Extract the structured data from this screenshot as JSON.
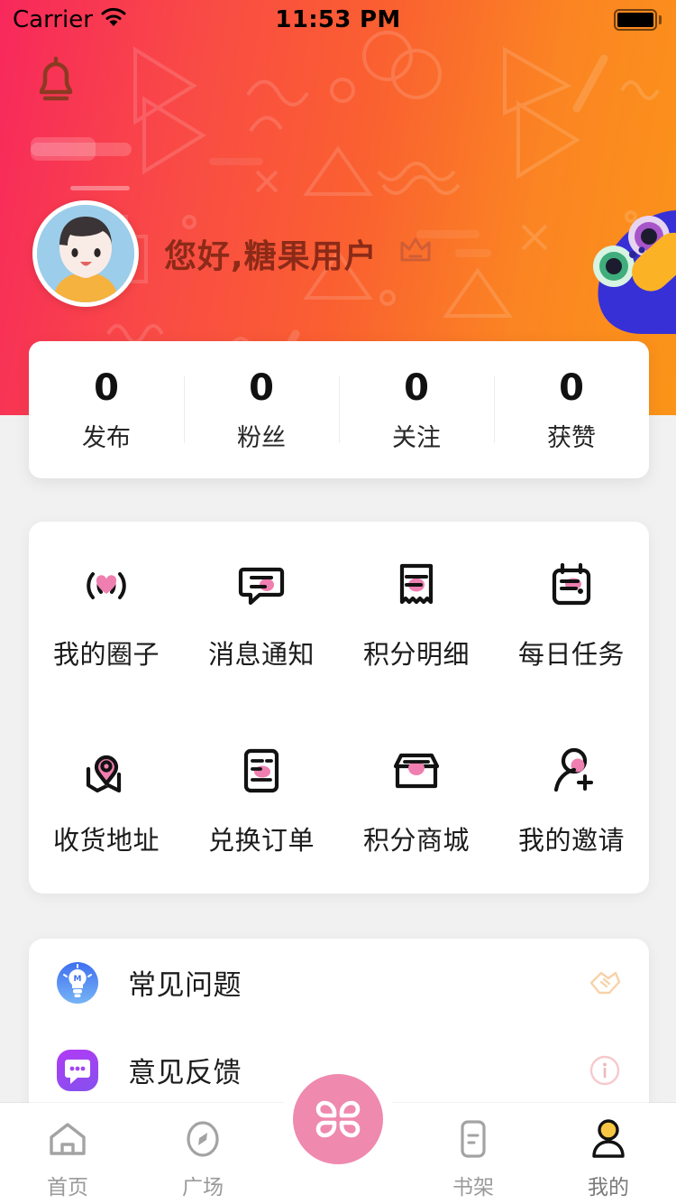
{
  "status_bar": {
    "carrier": "Carrier",
    "wifi_icon": "wifi-icon",
    "time": "11:53 PM",
    "battery_icon": "battery-full-icon"
  },
  "header": {
    "notification_icon": "bell-icon",
    "avatar_icon": "user-avatar",
    "greeting": "您好,糖果用户",
    "crown_icon": "crown-icon",
    "mascot_icon": "mascot-bird-icon",
    "gradient_start": "#f8285c",
    "gradient_end": "#fb9418",
    "greeting_color": "#8c2a18"
  },
  "stats": [
    {
      "value": "0",
      "label": "发布"
    },
    {
      "value": "0",
      "label": "粉丝"
    },
    {
      "value": "0",
      "label": "关注"
    },
    {
      "value": "0",
      "label": "获赞"
    }
  ],
  "grid": [
    {
      "label": "我的圈子",
      "icon": "broadcast-heart-icon"
    },
    {
      "label": "消息通知",
      "icon": "message-bubble-icon"
    },
    {
      "label": "积分明细",
      "icon": "receipt-icon"
    },
    {
      "label": "每日任务",
      "icon": "calendar-icon"
    },
    {
      "label": "收货地址",
      "icon": "map-pin-icon"
    },
    {
      "label": "兑换订单",
      "icon": "order-document-icon"
    },
    {
      "label": "积分商城",
      "icon": "store-icon"
    },
    {
      "label": "我的邀请",
      "icon": "user-plus-icon"
    }
  ],
  "list": [
    {
      "label": "常见问题",
      "icon": "lightbulb-icon",
      "right_icon": "handshake-icon",
      "icon_color": "#3b7af0"
    },
    {
      "label": "意见反馈",
      "icon": "chat-dots-icon",
      "right_icon": "info-circle-icon",
      "icon_color": "#a033f0"
    }
  ],
  "tabbar": {
    "items": [
      {
        "label": "首页",
        "icon": "home-icon",
        "active": false
      },
      {
        "label": "广场",
        "icon": "compass-icon",
        "active": false
      },
      {
        "label": "书架",
        "icon": "bookshelf-icon",
        "active": false
      },
      {
        "label": "我的",
        "icon": "profile-icon",
        "active": true
      }
    ],
    "fab_icon": "clover-flower-icon",
    "fab_color": "#ef89ae"
  },
  "theme": {
    "page_background": "#f1f1f1",
    "card_background": "#ffffff",
    "accent_pink": "#f06292"
  }
}
